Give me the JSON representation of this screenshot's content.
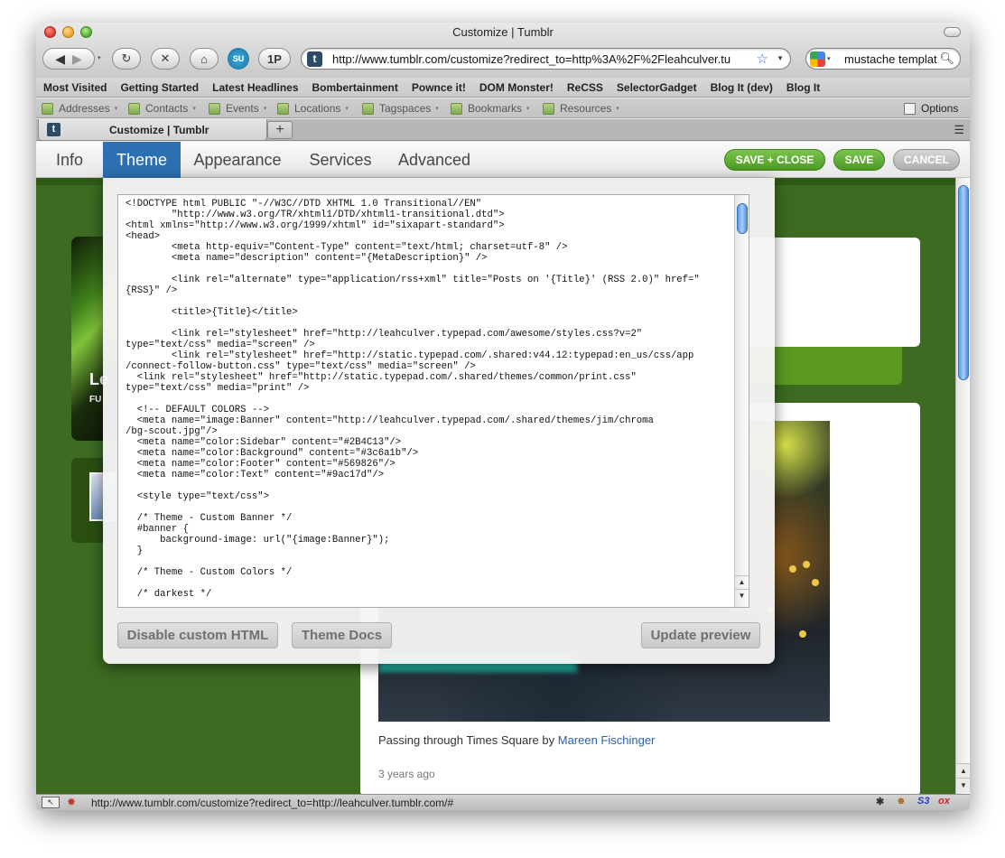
{
  "window": {
    "title": "Customize | Tumblr"
  },
  "toolbar": {
    "stumble_label": "SU",
    "onepass_label": "1P",
    "url": "http://www.tumblr.com/customize?redirect_to=http%3A%2F%2Fleahculver.tu",
    "search_value": "mustache templat",
    "tumblr_favicon": "t"
  },
  "bookmarks": [
    "Most Visited",
    "Getting Started",
    "Latest Headlines",
    "Bombertainment",
    "Pownce it!",
    "DOM Monster!",
    "ReCSS",
    "SelectorGadget",
    "Blog It (dev)",
    "Blog It"
  ],
  "toolbar2": {
    "items": [
      "Addresses",
      "Contacts",
      "Events",
      "Locations",
      "Tagspaces",
      "Bookmarks",
      "Resources"
    ],
    "options_label": "Options"
  },
  "tabs": {
    "active_title": "Customize | Tumblr",
    "new_tab": "+"
  },
  "tumblr": {
    "nav": [
      "Info",
      "Theme",
      "Appearance",
      "Services",
      "Advanced"
    ],
    "active_tab": "Theme",
    "save_close": "SAVE + CLOSE",
    "save": "SAVE",
    "cancel": "CANCEL",
    "panel_buttons": {
      "disable_html": "Disable custom HTML",
      "theme_docs": "Theme Docs",
      "update_preview": "Update preview"
    },
    "code_lines": [
      "<!DOCTYPE html PUBLIC \"-//W3C//DTD XHTML 1.0 Transitional//EN\"",
      "        \"http://www.w3.org/TR/xhtml1/DTD/xhtml1-transitional.dtd\">",
      "<html xmlns=\"http://www.w3.org/1999/xhtml\" id=\"sixapart-standard\">",
      "<head>",
      "        <meta http-equiv=\"Content-Type\" content=\"text/html; charset=utf-8\" />",
      "        <meta name=\"description\" content=\"{MetaDescription}\" />",
      "",
      "        <link rel=\"alternate\" type=\"application/rss+xml\" title=\"Posts on '{Title}' (RSS 2.0)\" href=\"",
      "{RSS}\" />",
      "",
      "        <title>{Title}</title>",
      "",
      "        <link rel=\"stylesheet\" href=\"http://leahculver.typepad.com/awesome/styles.css?v=2\"",
      "type=\"text/css\" media=\"screen\" />",
      "        <link rel=\"stylesheet\" href=\"http://static.typepad.com/.shared:v44.12:typepad:en_us/css/app",
      "/connect-follow-button.css\" type=\"text/css\" media=\"screen\" />",
      "  <link rel=\"stylesheet\" href=\"http://static.typepad.com/.shared/themes/common/print.css\"",
      "type=\"text/css\" media=\"print\" />",
      "",
      "  <!-- DEFAULT COLORS -->",
      "  <meta name=\"image:Banner\" content=\"http://leahculver.typepad.com/.shared/themes/jim/chroma",
      "/bg-scout.jpg\"/>",
      "  <meta name=\"color:Sidebar\" content=\"#2B4C13\"/>",
      "  <meta name=\"color:Background\" content=\"#3c6a1b\"/>",
      "  <meta name=\"color:Footer\" content=\"#569826\"/>",
      "  <meta name=\"color:Text\" content=\"#9ac17d\"/>",
      "",
      "  <style type=\"text/css\">",
      "",
      "  /* Theme - Custom Banner */",
      "  #banner {",
      "      background-image: url(\"{image:Banner}\");",
      "  }",
      "",
      "  /* Theme - Custom Colors */",
      "",
      "  /* darkest */"
    ],
    "page": {
      "sidebar_letters": "Le",
      "sidebar_sub": "FU",
      "caption_prefix": "Passing through Times Square by ",
      "caption_author": "Mareen Fischinger",
      "post_time": "3 years ago"
    }
  },
  "status": {
    "url": "http://www.tumblr.com/customize?redirect_to=http://leahculver.tumblr.com/#",
    "s3_label": "S3",
    "ox_label": "ox"
  },
  "colors": {
    "theme_tab": "#2d6fb3",
    "save_green": "#5aa72c",
    "page_background": "#3d6b21",
    "link_blue": "#2d5fa8"
  }
}
